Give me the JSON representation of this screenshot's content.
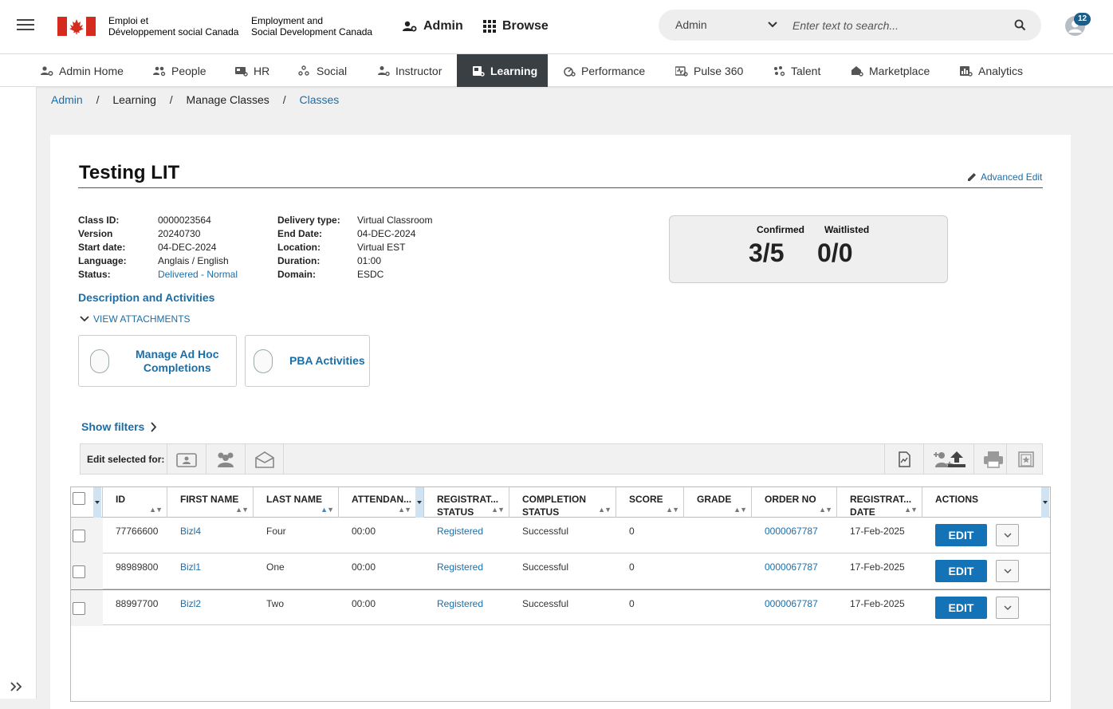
{
  "header": {
    "brand_fr_line1": "Emploi et",
    "brand_fr_line2": "Développement social Canada",
    "brand_en_line1": "Employment and",
    "brand_en_line2": "Social Development Canada",
    "admin_label": "Admin",
    "browse_label": "Browse",
    "search_scope": "Admin",
    "search_placeholder": "Enter text to search...",
    "notification_count": "12"
  },
  "subnav": {
    "items": [
      {
        "label": "Admin Home"
      },
      {
        "label": "People"
      },
      {
        "label": "HR"
      },
      {
        "label": "Social"
      },
      {
        "label": "Instructor"
      },
      {
        "label": "Learning"
      },
      {
        "label": "Performance"
      },
      {
        "label": "Pulse 360"
      },
      {
        "label": "Talent"
      },
      {
        "label": "Marketplace"
      },
      {
        "label": "Analytics"
      }
    ],
    "active": "Learning"
  },
  "breadcrumb": {
    "items": [
      "Admin",
      "Learning",
      "Manage Classes",
      "Classes"
    ],
    "separator": "/"
  },
  "class": {
    "title": "Testing LIT",
    "advanced_edit": "Advanced Edit",
    "left_labels": [
      "Class ID:",
      "Version",
      "Start date:",
      "Language:",
      "Status:"
    ],
    "left_values": [
      "0000023564",
      "20240730",
      "04-DEC-2024",
      "Anglais / English",
      "Delivered - Normal"
    ],
    "right_labels": [
      "Delivery type:",
      "End Date:",
      "Location:",
      "Duration:",
      "Domain:"
    ],
    "right_values": [
      "Virtual Classroom",
      "04-DEC-2024",
      "Virtual EST",
      "01:00",
      "ESDC"
    ],
    "confirmed_label": "Confirmed",
    "confirmed_value": "3/5",
    "waitlisted_label": "Waitlisted",
    "waitlisted_value": "0/0",
    "description_link": "Description and Activities",
    "view_attachments": "VIEW ATTACHMENTS",
    "tile_adhoc_line1": "Manage Ad Hoc",
    "tile_adhoc_line2": "Completions",
    "tile_pba": "PBA Activities"
  },
  "filters": {
    "show_filters": "Show filters",
    "edit_selected_for": "Edit selected for:"
  },
  "grid": {
    "columns": [
      {
        "line1": "ID",
        "line2": ""
      },
      {
        "line1": "FIRST NAME",
        "line2": ""
      },
      {
        "line1": "LAST NAME",
        "line2": ""
      },
      {
        "line1": "ATTENDAN...",
        "line2": ""
      },
      {
        "line1": "REGISTRAT...",
        "line2": "STATUS"
      },
      {
        "line1": "COMPLETION",
        "line2": "STATUS"
      },
      {
        "line1": "SCORE",
        "line2": ""
      },
      {
        "line1": "GRADE",
        "line2": ""
      },
      {
        "line1": "ORDER NO",
        "line2": ""
      },
      {
        "line1": "REGISTRAT...",
        "line2": "DATE"
      },
      {
        "line1": "ACTIONS",
        "line2": ""
      }
    ],
    "sorted_column": "LAST NAME",
    "sort_direction": "ascending",
    "rows": [
      {
        "id": "77766600",
        "first": "Bizl4",
        "last": "Four",
        "attendance": "00:00",
        "reg_status": "Registered",
        "completion": "Successful",
        "score": "0",
        "grade": "",
        "order_no": "0000067787",
        "reg_date": "17-Feb-2025",
        "action": "EDIT"
      },
      {
        "id": "98989800",
        "first": "Bizl1",
        "last": "One",
        "attendance": "00:00",
        "reg_status": "Registered",
        "completion": "Successful",
        "score": "0",
        "grade": "",
        "order_no": "0000067787",
        "reg_date": "17-Feb-2025",
        "action": "EDIT"
      },
      {
        "id": "88997700",
        "first": "Bizl2",
        "last": "Two",
        "attendance": "00:00",
        "reg_status": "Registered",
        "completion": "Successful",
        "score": "0",
        "grade": "",
        "order_no": "0000067787",
        "reg_date": "17-Feb-2025",
        "action": "EDIT"
      }
    ]
  },
  "colors": {
    "link": "#1a6ea8",
    "active_tab": "#3a3f44",
    "edit_button": "#1473b6",
    "badge": "#1b5e8a",
    "flag_red": "#d52b1e"
  }
}
